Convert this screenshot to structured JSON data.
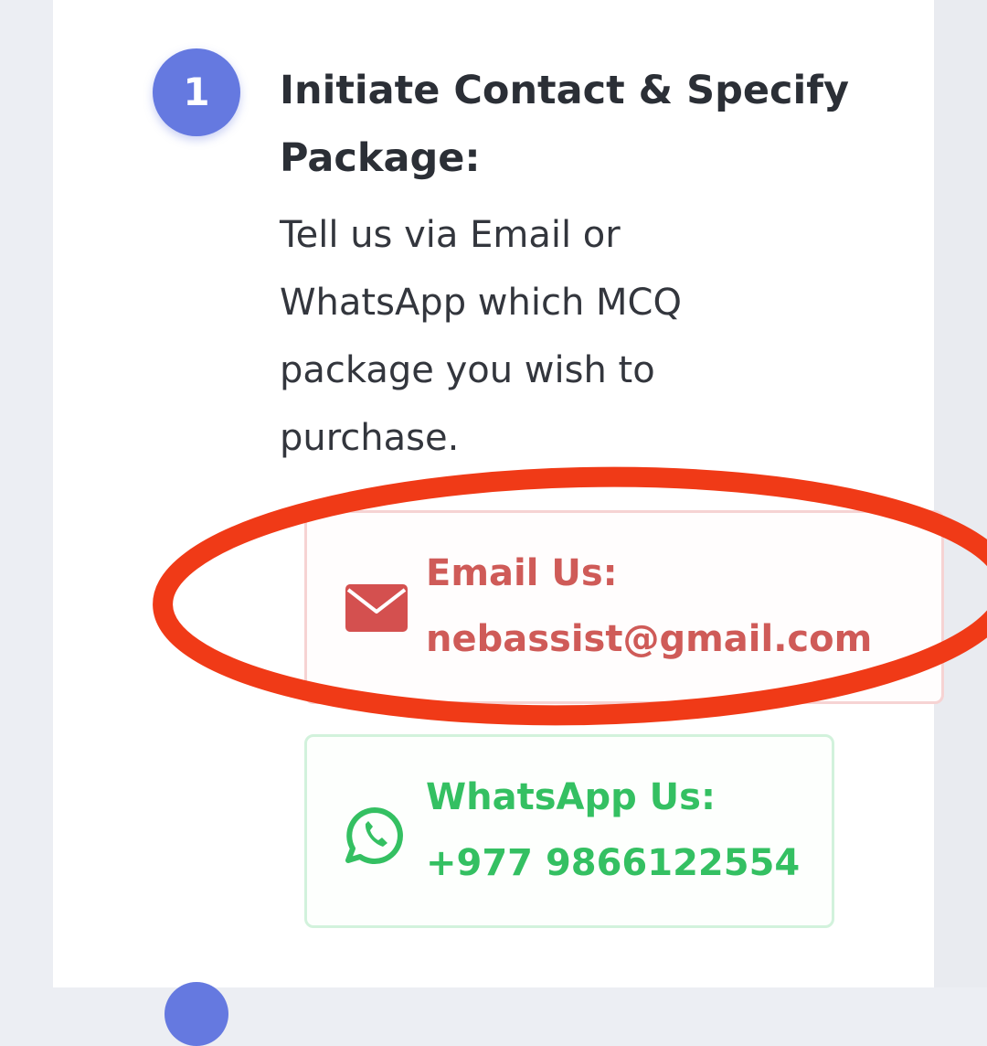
{
  "step": {
    "number": "1",
    "title": "Initiate Contact & Specify Package:",
    "description": "Tell us via Email or WhatsApp which MCQ package you wish to purchase."
  },
  "contacts": {
    "email": {
      "label": "Email Us:",
      "value": "nebassist@gmail.com",
      "icon": "envelope-icon",
      "color": "#cf5b58"
    },
    "whatsapp": {
      "label": "WhatsApp Us:",
      "value": "+977 9866122554",
      "icon": "whatsapp-icon",
      "color": "#34c062"
    }
  },
  "annotation": {
    "color": "#f03a17"
  },
  "colors": {
    "accent": "#6579e0",
    "text": "#2b2f36"
  }
}
